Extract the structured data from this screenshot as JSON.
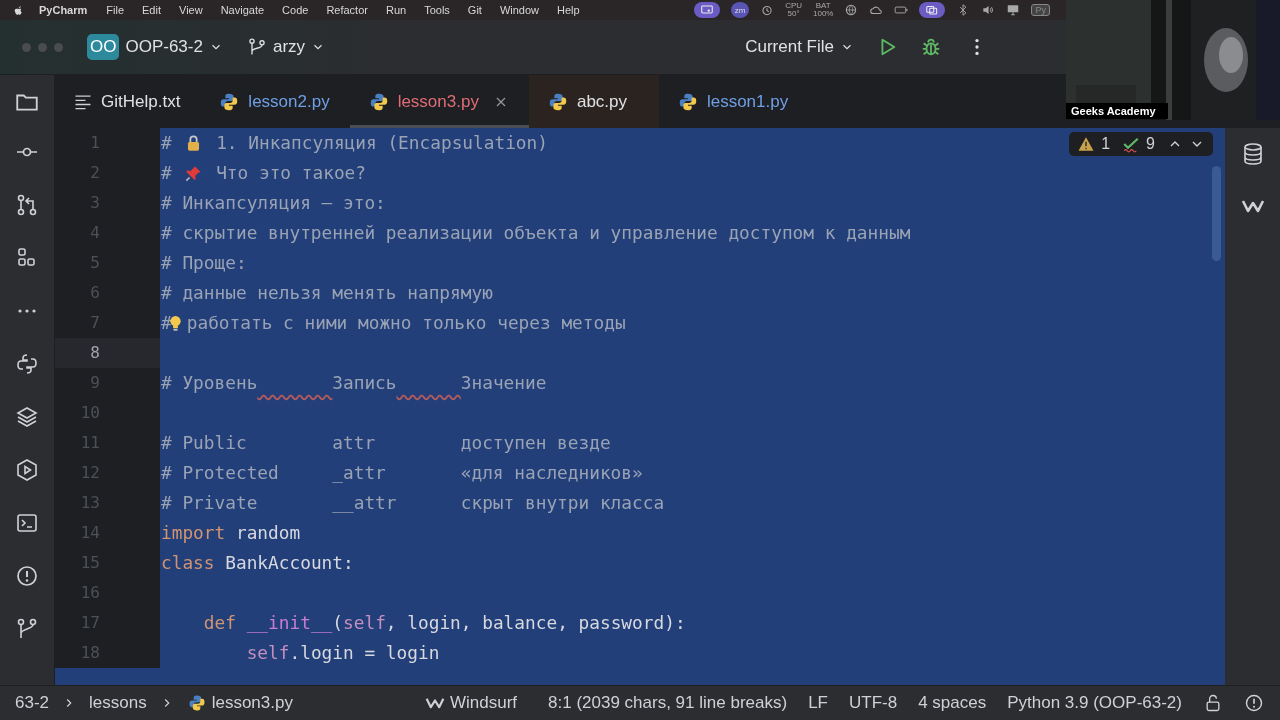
{
  "menubar": {
    "app": "PyCharm",
    "menus": [
      "File",
      "Edit",
      "View",
      "Navigate",
      "Code",
      "Refactor",
      "Run",
      "Tools",
      "Git",
      "Window",
      "Help"
    ],
    "status_items": [
      {
        "kind": "screen",
        "active": true
      },
      {
        "kind": "badge",
        "text": "zm"
      },
      {
        "kind": "timer",
        "active": false
      },
      {
        "kind": "stat",
        "label": "CPU",
        "value": "50°"
      },
      {
        "kind": "stat",
        "label": "BAT",
        "value": "100%"
      },
      {
        "kind": "globe",
        "active": false
      },
      {
        "kind": "cloud",
        "active": false
      },
      {
        "kind": "battery",
        "active": false
      },
      {
        "kind": "windows",
        "active": true
      },
      {
        "kind": "bluetooth",
        "active": false
      },
      {
        "kind": "volume",
        "active": false
      },
      {
        "kind": "display",
        "active": false
      },
      {
        "kind": "box",
        "text": "Py"
      }
    ]
  },
  "toolbar": {
    "project_badge": "OO",
    "project": "OOP-63-2",
    "branch": "arzy",
    "run_config": "Current File"
  },
  "tabs": [
    {
      "kind": "text",
      "label": "GitHelp.txt",
      "color": "#dfe1e5",
      "selected": false,
      "tinted": false
    },
    {
      "kind": "python",
      "label": "lesson2.py",
      "color": "#6f9fe6",
      "selected": false,
      "tinted": false
    },
    {
      "kind": "python",
      "label": "lesson3.py",
      "color": "#e06c75",
      "selected": true,
      "tinted": false
    },
    {
      "kind": "python",
      "label": "abc.py",
      "color": "#dfe1e5",
      "selected": false,
      "tinted": true
    },
    {
      "kind": "python",
      "label": "lesson1.py",
      "color": "#6f9fe6",
      "selected": false,
      "tinted": false
    }
  ],
  "left_toolbar": [
    {
      "kind": "commit"
    },
    {
      "kind": "pull"
    },
    {
      "kind": "structure"
    },
    {
      "kind": "more"
    },
    {
      "kind": "python"
    },
    {
      "kind": "layers"
    },
    {
      "kind": "services"
    },
    {
      "kind": "terminal"
    },
    {
      "kind": "problems"
    },
    {
      "kind": "git"
    }
  ],
  "right_toolbar": [
    {
      "kind": "database"
    },
    {
      "kind": "windsurf"
    }
  ],
  "inspections": {
    "warnings": "1",
    "typos": "9"
  },
  "editor": {
    "lines": [
      {
        "number": "1",
        "current": false,
        "tokens": [
          {
            "kind": "comment",
            "text": "# "
          },
          {
            "kind": "lock"
          },
          {
            "kind": "comment",
            "text": " 1. Инкапсуляция (Encapsulation)"
          }
        ]
      },
      {
        "number": "2",
        "current": false,
        "tokens": [
          {
            "kind": "comment",
            "text": "# "
          },
          {
            "kind": "pin"
          },
          {
            "kind": "comment",
            "text": " Что это такое?"
          }
        ]
      },
      {
        "number": "3",
        "current": false,
        "tokens": [
          {
            "kind": "comment",
            "text": "# Инкапсуляция — это:"
          }
        ]
      },
      {
        "number": "4",
        "current": false,
        "tokens": [
          {
            "kind": "comment",
            "text": "# скрытие внутренней реализации объекта и управление доступом к данным"
          }
        ]
      },
      {
        "number": "5",
        "current": false,
        "tokens": [
          {
            "kind": "comment",
            "text": "# Проще:"
          }
        ]
      },
      {
        "number": "6",
        "current": false,
        "tokens": [
          {
            "kind": "comment",
            "text": "# данные нельзя менять напрямую"
          }
        ]
      },
      {
        "number": "7",
        "current": false,
        "tokens": [
          {
            "kind": "comment",
            "text": "#"
          },
          {
            "kind": "bulb"
          },
          {
            "kind": "comment",
            "text": "работать с ними можно только через методы"
          }
        ]
      },
      {
        "number": "8",
        "current": true
      },
      {
        "number": "9",
        "current": false,
        "tokens": [
          {
            "kind": "typo-comment",
            "text": "# Уровень       Запись      Значение"
          }
        ]
      },
      {
        "number": "10",
        "current": false
      },
      {
        "number": "11",
        "current": false,
        "tokens": [
          {
            "kind": "comment",
            "text": "# Public        attr        доступен везде"
          }
        ]
      },
      {
        "number": "12",
        "current": false,
        "tokens": [
          {
            "kind": "comment",
            "text": "# Protected     _attr       «для наследников»"
          }
        ]
      },
      {
        "number": "13",
        "current": false,
        "tokens": [
          {
            "kind": "comment",
            "text": "# Private       __attr      скрыт внутри класса"
          }
        ]
      },
      {
        "number": "14",
        "current": false,
        "tokens": [
          {
            "kind": "keyword",
            "text": "import"
          },
          {
            "kind": "plain",
            "text": " random"
          }
        ]
      },
      {
        "number": "15",
        "current": false,
        "tokens": [
          {
            "kind": "keyword",
            "text": "class"
          },
          {
            "kind": "plain",
            "text": " BankAccount:"
          }
        ]
      },
      {
        "number": "16",
        "current": false
      },
      {
        "number": "17",
        "current": false,
        "tokens": [
          {
            "kind": "keyword",
            "text": "    def "
          },
          {
            "kind": "magic",
            "text": "__init__"
          },
          {
            "kind": "plain",
            "text": "("
          },
          {
            "kind": "self",
            "text": "self"
          },
          {
            "kind": "plain",
            "text": ", login, balance, password):"
          }
        ]
      },
      {
        "number": "18",
        "current": false,
        "tokens": [
          {
            "kind": "self",
            "text": "        self"
          },
          {
            "kind": "plain",
            "text": ".login = login"
          }
        ]
      }
    ]
  },
  "statusbar": {
    "breadcrumbs": [
      {
        "text": "63-2"
      },
      {
        "text": "lessons"
      },
      {
        "kind": "python",
        "text": "lesson3.py"
      }
    ],
    "items": [
      {
        "kind": "windsurf",
        "text": "Windsurf"
      },
      {
        "kind": "text",
        "text": "8:1 (2039 chars, 91 line breaks)"
      },
      {
        "kind": "text",
        "text": "LF"
      },
      {
        "kind": "text",
        "text": "UTF-8"
      },
      {
        "kind": "text",
        "text": "4 spaces"
      },
      {
        "kind": "text",
        "text": "Python 3.9 (OOP-63-2)"
      },
      {
        "kind": "lock"
      },
      {
        "kind": "alert"
      }
    ]
  },
  "video": {
    "kind": "picture",
    "caption": "Geeks Academy"
  }
}
